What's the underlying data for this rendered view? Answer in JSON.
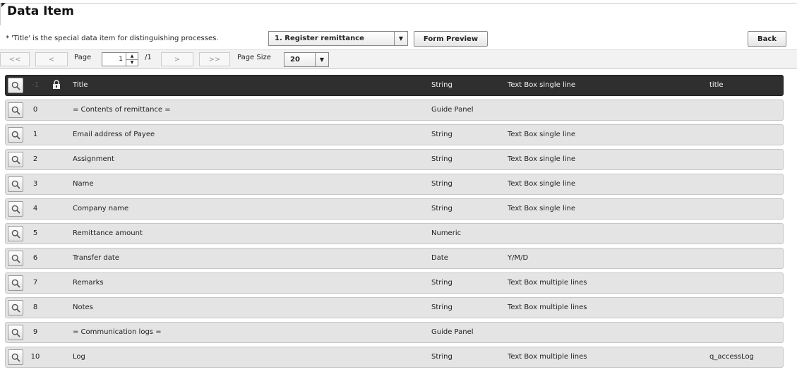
{
  "header": {
    "title": "Data Item",
    "note": "* 'Title' is the special data item for distinguishing processes.",
    "process_select": "1. Register remittance",
    "form_preview_label": "Form Preview",
    "back_label": "Back"
  },
  "pager": {
    "first": "<<",
    "prev": "<",
    "page_label": "Page",
    "page_value": "1",
    "page_total": "/1",
    "next": ">",
    "last": ">>",
    "page_size_label": "Page Size",
    "page_size_value": "20"
  },
  "table": {
    "header": {
      "num": "-1",
      "title": "Title",
      "type": "String",
      "control": "Text Box single line",
      "field": "title"
    },
    "rows": [
      {
        "num": "0",
        "title": "= Contents of remittance =",
        "type": "Guide Panel",
        "control": "",
        "field": ""
      },
      {
        "num": "1",
        "title": "Email address of Payee",
        "type": "String",
        "control": "Text Box single line",
        "field": ""
      },
      {
        "num": "2",
        "title": "Assignment",
        "type": "String",
        "control": "Text Box single line",
        "field": ""
      },
      {
        "num": "3",
        "title": "Name",
        "type": "String",
        "control": "Text Box single line",
        "field": ""
      },
      {
        "num": "4",
        "title": "Company name",
        "type": "String",
        "control": "Text Box single line",
        "field": ""
      },
      {
        "num": "5",
        "title": "Remittance amount",
        "type": "Numeric",
        "control": "",
        "field": ""
      },
      {
        "num": "6",
        "title": "Transfer date",
        "type": "Date",
        "control": "Y/M/D",
        "field": ""
      },
      {
        "num": "7",
        "title": "Remarks",
        "type": "String",
        "control": "Text Box multiple lines",
        "field": ""
      },
      {
        "num": "8",
        "title": "Notes",
        "type": "String",
        "control": "Text Box multiple lines",
        "field": ""
      },
      {
        "num": "9",
        "title": "= Communication logs =",
        "type": "Guide Panel",
        "control": "",
        "field": ""
      },
      {
        "num": "10",
        "title": "Log",
        "type": "String",
        "control": "Text Box multiple lines",
        "field": "q_accessLog"
      }
    ]
  },
  "icons": {
    "search": "magnifier-icon",
    "lock": "lock-icon",
    "dropdown": "triangle-down-icon"
  }
}
